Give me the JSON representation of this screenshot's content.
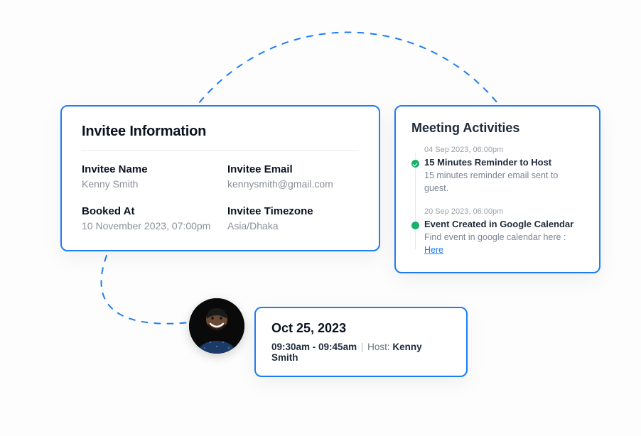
{
  "invitee": {
    "heading": "Invitee Information",
    "name_label": "Invitee Name",
    "name_value": "Kenny Smith",
    "email_label": "Invitee Email",
    "email_value": "kennysmith@gmail.com",
    "booked_label": "Booked At",
    "booked_value": "10 November 2023, 07:00pm",
    "tz_label": "Invitee Timezone",
    "tz_value": "Asia/Dhaka"
  },
  "activities": {
    "heading": "Meeting Activities",
    "items": [
      {
        "ts": "04 Sep 2023, 06:00pm",
        "title": "15 Minutes Reminder to Host",
        "desc": "15 minutes reminder email sent to guest."
      },
      {
        "ts": "20 Sep 2023, 06:00pm",
        "title": "Event Created in Google Calendar",
        "desc_prefix": "Find event in google calendar here : ",
        "link_text": "Here"
      }
    ]
  },
  "booking": {
    "date": "Oct 25, 2023",
    "time_range": "09:30am - 09:45am",
    "host_label": "Host:",
    "host_name": "Kenny Smith"
  },
  "colors": {
    "accent": "#1e7df0",
    "success": "#17b26a"
  }
}
